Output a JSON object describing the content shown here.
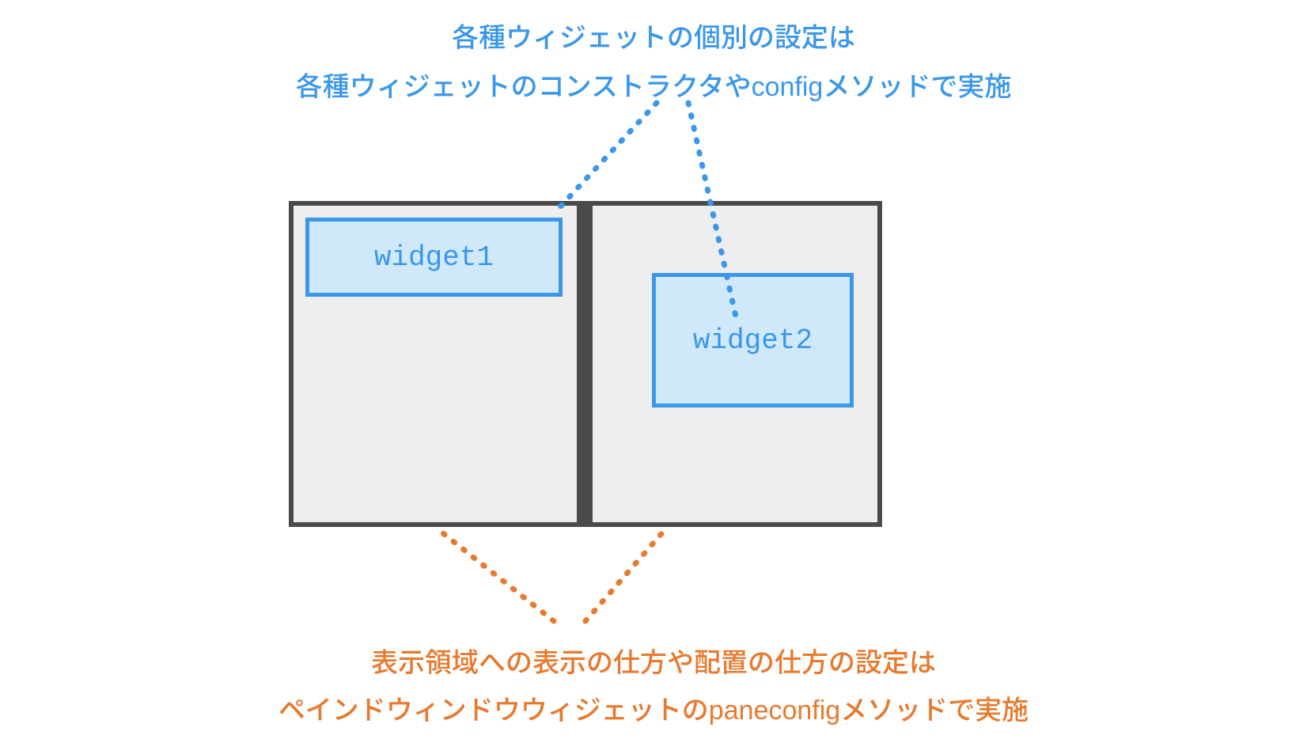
{
  "top": {
    "line1": "各種ウィジェットの個別の設定は",
    "line2": "各種ウィジェットのコンストラクタやconfigメソッドで実施"
  },
  "bottom": {
    "line1": "表示領域への表示の仕方や配置の仕方の設定は",
    "line2": "ペインドウィンドウウィジェットのpaneconfigメソッドで実施"
  },
  "widgets": {
    "w1": "widget1",
    "w2": "widget2"
  },
  "colors": {
    "blue": "#3b97ea",
    "orange": "#e77a2f",
    "frame": "#4a4a4a",
    "widgetFill": "#cfe9fa",
    "paneFill": "#eeeeee"
  }
}
